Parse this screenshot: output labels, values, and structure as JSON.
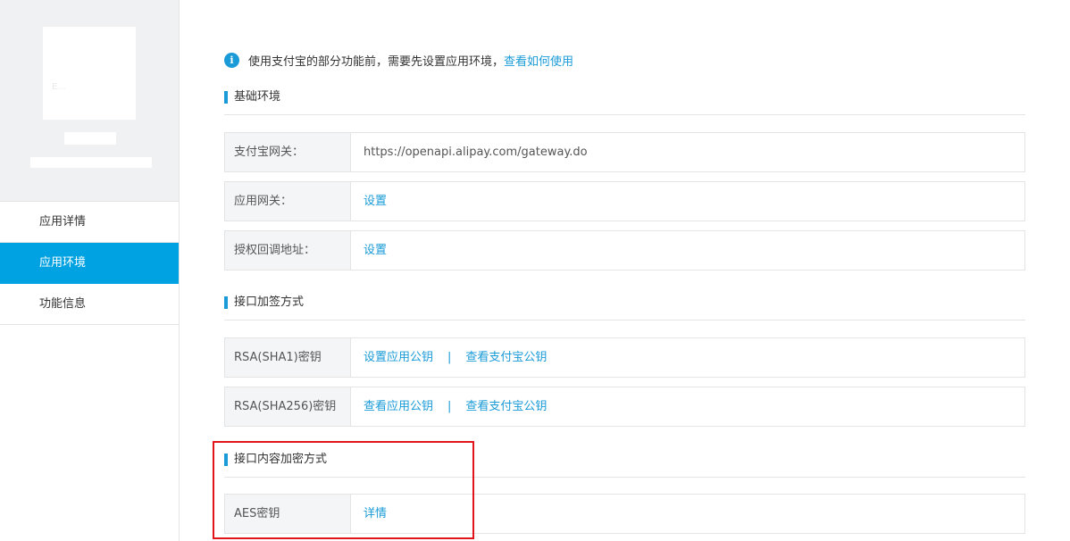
{
  "sidebar": {
    "logo_text": "E...",
    "nav": [
      {
        "label": "应用详情",
        "active": false
      },
      {
        "label": "应用环境",
        "active": true
      },
      {
        "label": "功能信息",
        "active": false
      }
    ]
  },
  "notice": {
    "icon": "info-icon",
    "text": "使用支付宝的部分功能前，需要先设置应用环境，",
    "link": "查看如何使用"
  },
  "sections": {
    "basic": {
      "title": "基础环境",
      "rows": [
        {
          "label": "支付宝网关：",
          "value": "https://openapi.alipay.com/gateway.do"
        },
        {
          "label": "应用网关：",
          "link": "设置"
        },
        {
          "label": "授权回调地址：",
          "link": "设置"
        }
      ]
    },
    "sign": {
      "title": "接口加签方式",
      "rows": [
        {
          "label": "RSA(SHA1)密钥",
          "link1": "设置应用公钥",
          "separator": "|",
          "link2": "查看支付宝公钥"
        },
        {
          "label": "RSA(SHA256)密钥",
          "link1": "查看应用公钥",
          "separator": "|",
          "link2": "查看支付宝公钥"
        }
      ]
    },
    "encrypt": {
      "title": "接口内容加密方式",
      "rows": [
        {
          "label": "AES密钥",
          "link": "详情"
        }
      ]
    }
  },
  "colors": {
    "accent": "#1a9bd7",
    "nav_active": "#00a2e1",
    "highlight": "#e0161c"
  }
}
